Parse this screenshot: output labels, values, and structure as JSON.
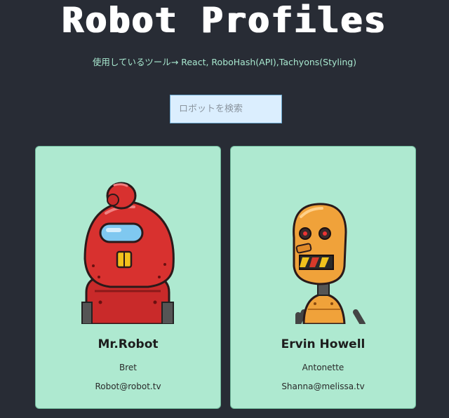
{
  "header": {
    "title": "Robot Profiles",
    "subtitle": "使用しているツール→ React, RoboHash(API),Tachyons(Styling)"
  },
  "search": {
    "placeholder": "ロボットを検索",
    "value": ""
  },
  "robots": [
    {
      "name": "Mr.Robot",
      "username": "Bret",
      "email": "Robot@robot.tv"
    },
    {
      "name": "Ervin Howell",
      "username": "Antonette",
      "email": "Shanna@melissa.tv"
    }
  ],
  "colors": {
    "background": "#282c35",
    "card": "#aee9d0",
    "accent_text": "#a8e8cf",
    "search_bg": "#dbeefe"
  }
}
